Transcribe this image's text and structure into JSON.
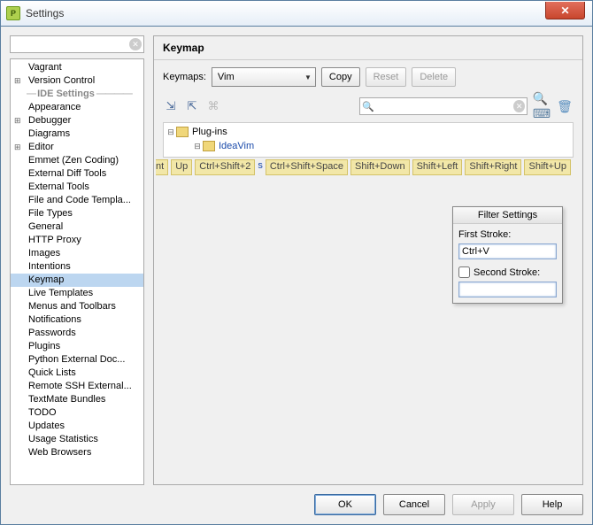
{
  "window": {
    "title": "Settings"
  },
  "sidebar": {
    "search": {
      "placeholder": ""
    },
    "items": [
      {
        "label": "Vagrant"
      },
      {
        "label": "Version Control",
        "expander": true
      },
      {
        "label": "IDE Settings",
        "section": true
      },
      {
        "label": "Appearance"
      },
      {
        "label": "Debugger",
        "expander": true
      },
      {
        "label": "Diagrams"
      },
      {
        "label": "Editor",
        "expander": true
      },
      {
        "label": "Emmet (Zen Coding)"
      },
      {
        "label": "External Diff Tools"
      },
      {
        "label": "External Tools"
      },
      {
        "label": "File and Code Templa..."
      },
      {
        "label": "File Types"
      },
      {
        "label": "General"
      },
      {
        "label": "HTTP Proxy"
      },
      {
        "label": "Images"
      },
      {
        "label": "Intentions"
      },
      {
        "label": "Keymap",
        "selected": true
      },
      {
        "label": "Live Templates"
      },
      {
        "label": "Menus and Toolbars"
      },
      {
        "label": "Notifications"
      },
      {
        "label": "Passwords"
      },
      {
        "label": "Plugins"
      },
      {
        "label": "Python External Doc..."
      },
      {
        "label": "Quick Lists"
      },
      {
        "label": "Remote SSH External..."
      },
      {
        "label": "TextMate Bundles"
      },
      {
        "label": "TODO"
      },
      {
        "label": "Updates"
      },
      {
        "label": "Usage Statistics"
      },
      {
        "label": "Web Browsers"
      }
    ]
  },
  "keymap": {
    "title": "Keymap",
    "keymaps_label": "Keymaps:",
    "selected_keymap": "Vim",
    "copy_label": "Copy",
    "reset_label": "Reset",
    "delete_label": "Delete",
    "tree": {
      "root": "Plug-ins",
      "child": "IdeaVim"
    },
    "chips": [
      "nt",
      "Up",
      "Ctrl+Shift+2",
      "s",
      "Ctrl+Shift+Space",
      "Shift+Down",
      "Shift+Left",
      "Shift+Right",
      "Shift+Up"
    ],
    "filter_popup": {
      "title": "Filter Settings",
      "first_label": "First Stroke:",
      "first_value": "Ctrl+V",
      "second_label": "Second Stroke:"
    }
  },
  "footer": {
    "ok": "OK",
    "cancel": "Cancel",
    "apply": "Apply",
    "help": "Help"
  }
}
